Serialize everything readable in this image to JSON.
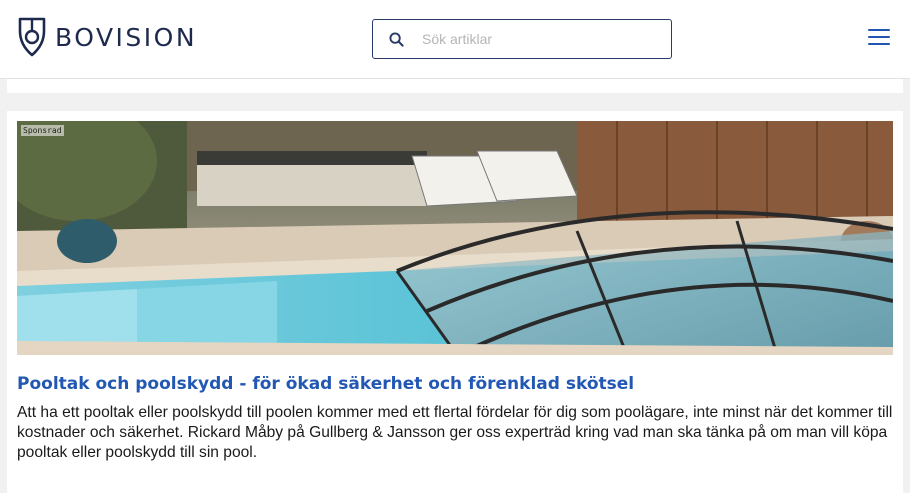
{
  "header": {
    "logo_text": "BOVISION",
    "search_placeholder": "Sök artiklar",
    "search_value": "",
    "brand_color": "#1d2a4d",
    "accent_color": "#2255b0"
  },
  "article": {
    "sponsored_label": "Sponsrad",
    "title": "Pooltak och poolskydd - för ökad säkerhet och förenklad skötsel",
    "description": "Att ha ett pooltak eller poolskydd till poolen kommer med ett flertal fördelar för dig som poolägare, inte minst när det kommer till kostnader och säkerhet. Rickard Måby på Gullberg & Jansson ger oss experträd kring vad man ska tänka på om man vill köpa pooltak eller poolskydd till sin pool.",
    "image_subject": "pool-with-sliding-enclosure-photo"
  }
}
